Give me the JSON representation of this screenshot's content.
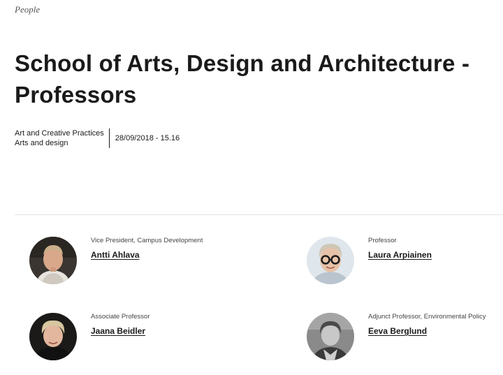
{
  "header": {
    "category_link": "People",
    "title_line1": "School of Arts, Design and Architecture -",
    "title_line2": "Professors"
  },
  "meta": {
    "tags": [
      "Art and Creative Practices",
      "Arts and design"
    ],
    "date": "28/09/2018 - 15.16"
  },
  "people": [
    {
      "role": "Vice President, Campus Development",
      "name": "Antti Ahlava"
    },
    {
      "role": "Professor",
      "name": "Laura Arpiainen"
    },
    {
      "role": "Associate Professor",
      "name": "Jaana Beidler"
    },
    {
      "role": "Adjunct Professor, Environmental Policy",
      "name": "Eeva Berglund"
    }
  ],
  "colors": {
    "text": "#1a1a1a",
    "divider": "#e4e4e4"
  }
}
